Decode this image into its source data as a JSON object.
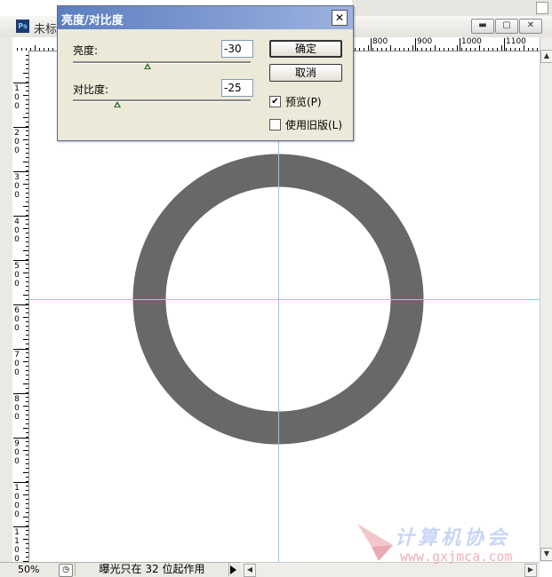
{
  "document": {
    "app_badge": "Ps",
    "title_partial": "未标",
    "window_controls": [
      "minimize",
      "restore",
      "close"
    ]
  },
  "rulers": {
    "horizontal_labels": [
      "800",
      "900",
      "1000",
      "1100"
    ],
    "vertical_labels": [
      "100",
      "200",
      "300",
      "400",
      "500",
      "600",
      "700",
      "800",
      "900",
      "1000",
      "1100"
    ]
  },
  "dialog": {
    "title": "亮度/对比度",
    "brightness_label": "亮度:",
    "brightness_value": "-30",
    "contrast_label": "对比度:",
    "contrast_value": "-25",
    "brightness_slider_fraction": 0.42,
    "contrast_slider_fraction": 0.25,
    "ok_label": "确定",
    "cancel_label": "取消",
    "preview_label": "预览(P)",
    "preview_checked": true,
    "legacy_label": "使用旧版(L)",
    "legacy_checked": false
  },
  "canvas": {
    "ring_color": "#696867",
    "guide_color": "#79d7e6"
  },
  "status": {
    "zoom": "50%",
    "message": "曝光只在 32 位起作用"
  },
  "watermark": {
    "text": "计算机协会",
    "url": "www.gxjmca.com"
  }
}
